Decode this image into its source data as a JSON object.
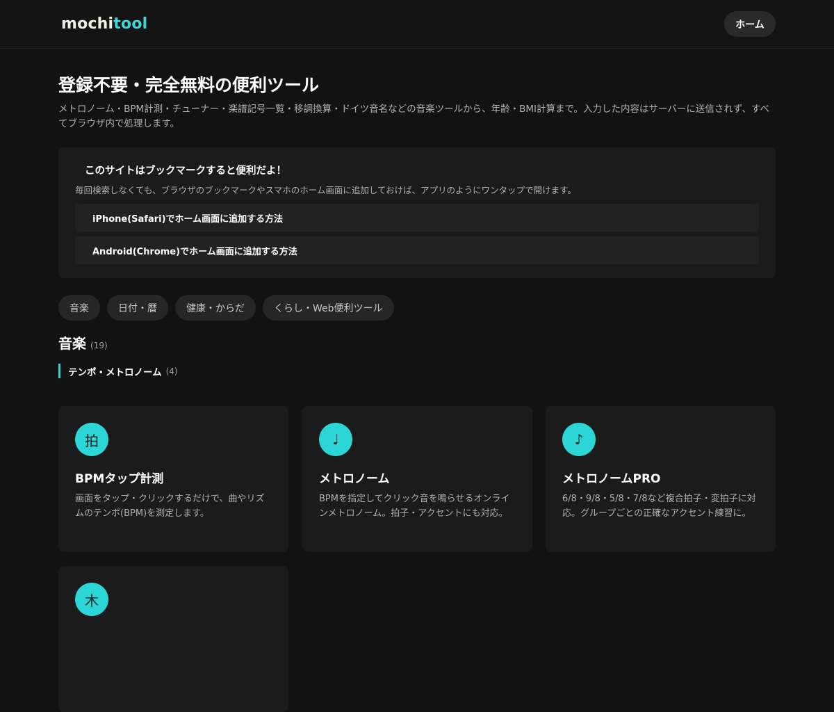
{
  "header": {
    "logo_part1": "mochi",
    "logo_part2": "tool",
    "home_label": "ホーム"
  },
  "hero": {
    "title": "登録不要・完全無料の便利ツール",
    "description": "メトロノーム・BPM計測・チューナー・楽譜記号一覧・移調換算・ドイツ音名などの音楽ツールから、年齢・BMI計算まで。入力した内容はサーバーに送信されず、すべてブラウザ内で処理します。"
  },
  "bookmark": {
    "title": "このサイトはブックマークすると便利だよ！",
    "description": "毎回検索しなくても、ブラウザのブックマークやスマホのホーム画面に追加しておけば、アプリのようにワンタップで開けます。",
    "ios_label": "iPhone(Safari)でホーム画面に追加する方法",
    "android_label": "Android(Chrome)でホーム画面に追加する方法"
  },
  "categories": [
    {
      "label": "音楽"
    },
    {
      "label": "日付・暦"
    },
    {
      "label": "健康・からだ"
    },
    {
      "label": "くらし・Web便利ツール"
    }
  ],
  "section": {
    "title": "音楽",
    "count": "(19)",
    "subsection_title": "テンポ・メトロノーム",
    "subsection_count": "(4)"
  },
  "cards": [
    {
      "icon": "拍",
      "icon_name": "beat-kanji-icon",
      "name": "BPMタップ計測",
      "description": "画面をタップ・クリックするだけで、曲やリズムのテンポ(BPM)を測定します。"
    },
    {
      "icon": "♩",
      "icon_name": "quarter-note-icon",
      "name": "メトロノーム",
      "description": "BPMを指定してクリック音を鳴らせるオンラインメトロノーム。拍子・アクセントにも対応。"
    },
    {
      "icon": "♪",
      "icon_name": "eighth-note-icon",
      "name": "メトロノームPRO",
      "description": "6/8・9/8・5/8・7/8など複合拍子・変拍子に対応。グループごとの正確なアクセント練習に。"
    },
    {
      "icon": "木",
      "icon_name": "wood-kanji-icon",
      "name": "",
      "description": ""
    }
  ],
  "colors": {
    "background": "#121212",
    "accent": "#2cd6d6",
    "card": "#1b1b1b"
  }
}
